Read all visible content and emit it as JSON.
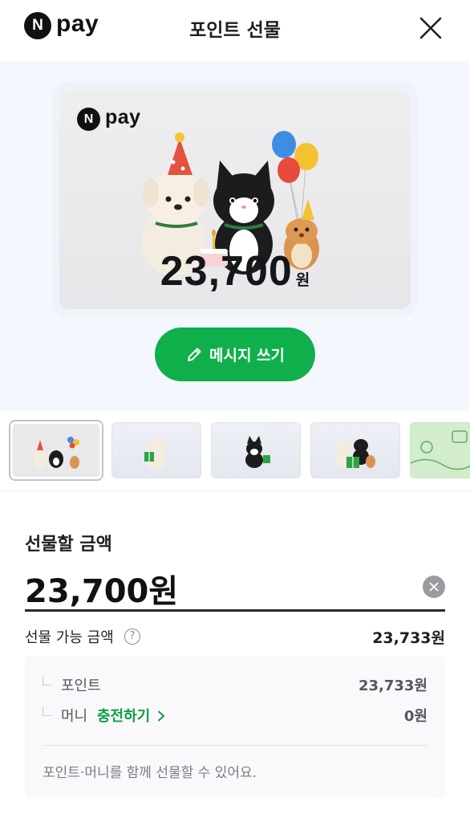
{
  "header": {
    "logo_mark": "N",
    "logo_text": "pay",
    "title": "포인트 선물"
  },
  "card": {
    "logo_mark": "N",
    "logo_text": "pay",
    "amount": "23,700",
    "currency": "원"
  },
  "message_button": {
    "label": "메시지 쓰기",
    "icon": "pencil-icon"
  },
  "thumbnails": [
    {
      "name": "party-friends",
      "selected": true
    },
    {
      "name": "dog-gift",
      "selected": false
    },
    {
      "name": "cat-gift",
      "selected": false
    },
    {
      "name": "friends-gift",
      "selected": false
    },
    {
      "name": "green-illustration",
      "selected": false
    }
  ],
  "gift_amount": {
    "label": "선물할 금액",
    "value": "23,700원"
  },
  "available": {
    "label": "선물 가능 금액",
    "help_icon": "?",
    "value": "23,733원"
  },
  "breakdown": {
    "points_label": "포인트",
    "points_value": "23,733원",
    "money_label": "머니",
    "charge_label": "충전하기",
    "charge_icon": "chevron-right-icon",
    "money_value": "0원",
    "note": "포인트·머니를 함께 선물할 수 있어요."
  },
  "colors": {
    "brand_green": "#0fb04b",
    "hero_background": "#f4f7fd",
    "breakdown_background": "#fbf8fc"
  }
}
